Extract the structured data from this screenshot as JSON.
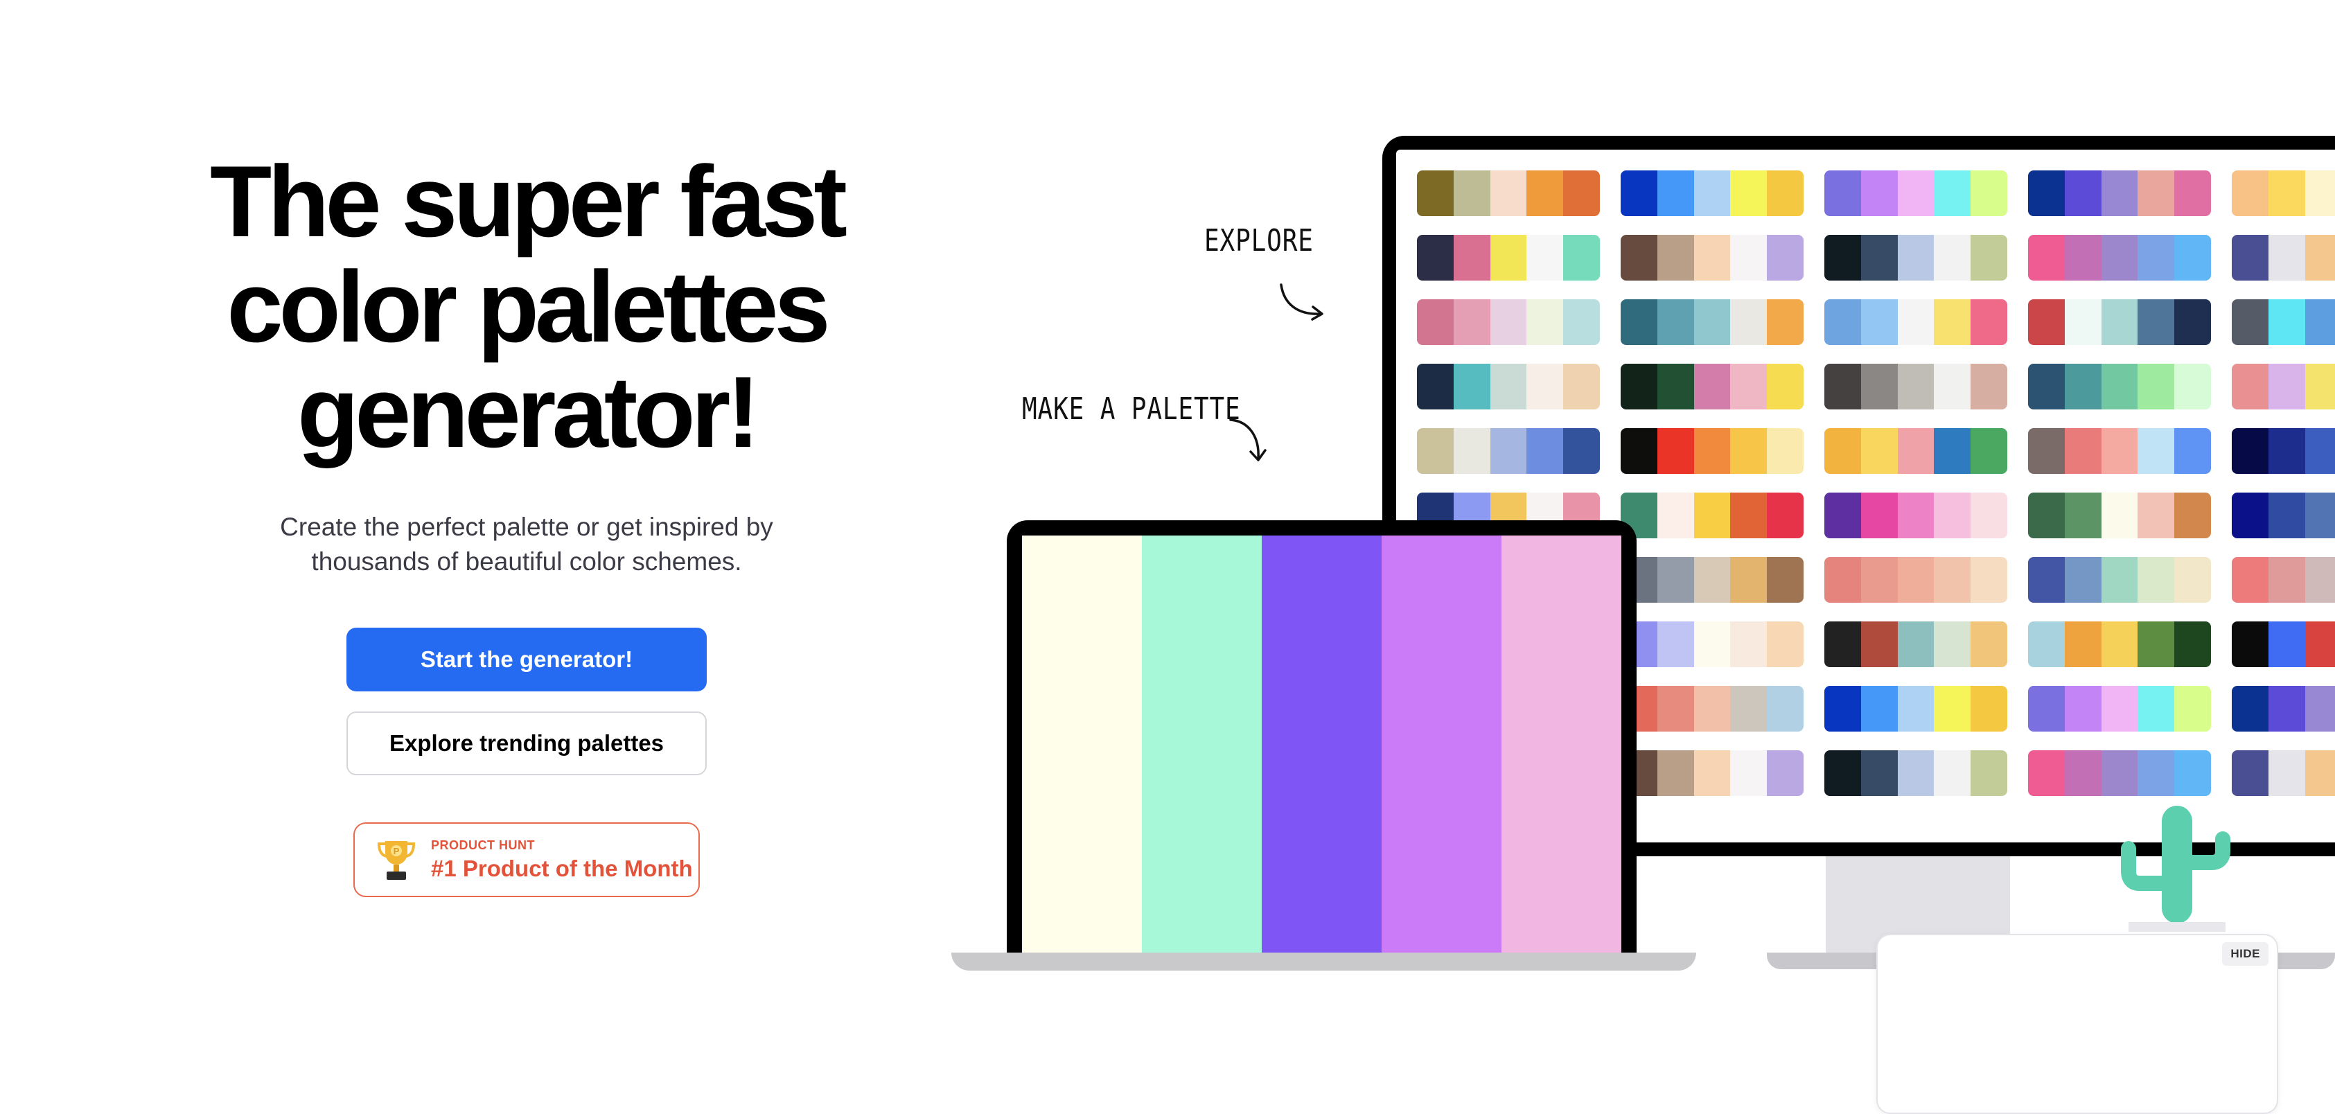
{
  "hero": {
    "title_lines": [
      "The super fast",
      "color palettes",
      "generator!"
    ],
    "subtitle_lines": [
      "Create the perfect palette or get inspired by",
      "thousands of beautiful color schemes."
    ],
    "primary_button": "Start the generator!",
    "secondary_button": "Explore trending palettes"
  },
  "badge": {
    "kicker": "PRODUCT HUNT",
    "title": "#1 Product of the Month",
    "icon": "trophy-icon"
  },
  "annotations": {
    "explore": "EXPLORE",
    "make": "MAKE A PALETTE"
  },
  "widget": {
    "hide_label": "HIDE"
  },
  "colors": {
    "primary": "#246bf2",
    "badge_accent": "#e3533a",
    "cactus": "#5ccfae"
  },
  "laptop_palette": [
    "#fffeea",
    "#a6f8d9",
    "#7f55f5",
    "#cb7bf8",
    "#f2b6e3"
  ],
  "monitor_palettes": [
    [
      "#7d6a24",
      "#bdbc94",
      "#f8dccb",
      "#ef9b3b",
      "#e06f37"
    ],
    [
      "#0936c1",
      "#4598f7",
      "#aed2f4",
      "#f5f55a",
      "#f5c842"
    ],
    [
      "#7a70e0",
      "#c384f6",
      "#f1b4f4",
      "#77f2f2",
      "#d8fd8a"
    ],
    [
      "#0b3291",
      "#5b4bd6",
      "#9887d2",
      "#e9a69c",
      "#e06fa3"
    ],
    [
      "#f8c287",
      "#fbd85e",
      "#fdf3cc",
      "#e9d4aa",
      "#ed8c3a"
    ],
    [
      "#2c2d46",
      "#da7091",
      "#f3e656",
      "#f6f6f6",
      "#75dbba"
    ],
    [
      "#684b3f",
      "#b99e88",
      "#f7d4b4",
      "#f6f4f4",
      "#b9a8e1"
    ],
    [
      "#111b22",
      "#374b66",
      "#b8c8e5",
      "#f2f2f2",
      "#c2cc99"
    ],
    [
      "#ef5b93",
      "#c36fb6",
      "#9c86cc",
      "#7ba3e5",
      "#61b6f6"
    ],
    [
      "#4a4e92",
      "#e4e4ea",
      "#f4c78f",
      "#e9a46c",
      "#f7e5cd"
    ],
    [
      "#d17590",
      "#e49fb5",
      "#e8d0e3",
      "#eef3df",
      "#b9dee0"
    ],
    [
      "#2f6b7d",
      "#5fa1b1",
      "#90c6ce",
      "#eae8e3",
      "#f2a94a"
    ],
    [
      "#6ea5e0",
      "#94c6f4",
      "#f4f4f4",
      "#f8e16e",
      "#ef6a89"
    ],
    [
      "#cb4649",
      "#eef9f5",
      "#a8d7d3",
      "#4f7599",
      "#1e2f52"
    ],
    [
      "#555c67",
      "#5fe6f5",
      "#5d9ee0",
      "#e8714a",
      "#a84d3f"
    ],
    [
      "#1c2c44",
      "#56bcc0",
      "#c9dbd4",
      "#f6eee7",
      "#efd2b0"
    ],
    [
      "#12231a",
      "#215132",
      "#d37daa",
      "#efb7c4",
      "#f6dc50"
    ],
    [
      "#454140",
      "#8b8784",
      "#c0bcb6",
      "#f1f1ef",
      "#d6aea2"
    ],
    [
      "#2c5371",
      "#4c9a9c",
      "#72c8a1",
      "#9eea9e",
      "#d6fbd6"
    ],
    [
      "#e99192",
      "#d9b4ea",
      "#f4e36d",
      "#e7b4bb",
      "#c4e8ed"
    ],
    [
      "#cbc29b",
      "#e9e8e0",
      "#a5b7e1",
      "#6d8ee0",
      "#33549d"
    ],
    [
      "#0e0e0d",
      "#ea3428",
      "#f28a3d",
      "#f7c547",
      "#fbeaad"
    ],
    [
      "#f2b33f",
      "#f9d65e",
      "#efa3a9",
      "#2f7bbf",
      "#4ba860"
    ],
    [
      "#7a6b69",
      "#ea7b7b",
      "#f4a9a1",
      "#c0e4f6",
      "#5f93f4"
    ],
    [
      "#060a47",
      "#1c2d8e",
      "#3c5fbf",
      "#66e0bf",
      "#dbeed8"
    ],
    [
      "#1f3474",
      "#8d9af1",
      "#f3c65d",
      "#f7f3f3",
      "#e993a8"
    ],
    [
      "#3d8a6f",
      "#fcefe9",
      "#f8ce44",
      "#e06436",
      "#e7334a"
    ],
    [
      "#5e2fa0",
      "#e647a2",
      "#ee82c7",
      "#f5bfdd",
      "#f9dfe3"
    ],
    [
      "#3b6a4b",
      "#5d9466",
      "#fcfbeb",
      "#f1c2b5",
      "#d2884d"
    ],
    [
      "#0b1189",
      "#2f4ca2",
      "#5274b3",
      "#8cb1d6",
      "#a4cbe3"
    ],
    [
      "#5c5e7e",
      "#a598bf",
      "#b5c3da",
      "#d5f3ea",
      "#d8c99f"
    ],
    [
      "#6a737f",
      "#949ca9",
      "#d7c9b5",
      "#e3b46e",
      "#9e7452"
    ],
    [
      "#e5837d",
      "#e99c8d",
      "#eeae9a",
      "#f1c3aa",
      "#f6dcc0"
    ],
    [
      "#4356a5",
      "#7597c6",
      "#9fd7c3",
      "#d9e9c9",
      "#f2e7c9"
    ],
    [
      "#ee7b7b",
      "#df9a9a",
      "#d0b9b9",
      "#b6dad8",
      "#abf5f1"
    ],
    [
      "#a1538e",
      "#d274a5",
      "#e3ab9f",
      "#f2e0b6",
      "#adf2df"
    ],
    [
      "#9090f0",
      "#c0c4f4",
      "#fcfbee",
      "#f9eadf",
      "#f7d7b4"
    ],
    [
      "#222222",
      "#ae4b3d",
      "#8cbfbd",
      "#d8e4d2",
      "#f1c57a"
    ],
    [
      "#a9d2df",
      "#eea33e",
      "#f6d15a",
      "#5c8d40",
      "#1e4720"
    ],
    [
      "#0b0b0b",
      "#3f6cf2",
      "#d8433f",
      "#f6c651",
      "#e8e8e4"
    ],
    [
      "#f3f155",
      "#d1f27c",
      "#a9ef96",
      "#86ecc1",
      "#6be9ee"
    ],
    [
      "#e36a5b",
      "#e88b7f",
      "#f2c0a8",
      "#ccc6bd",
      "#b1d0e4"
    ],
    [
      "#0936c1",
      "#4598f7",
      "#aed2f4",
      "#f5f55a",
      "#f5c842"
    ],
    [
      "#7a70e0",
      "#c384f6",
      "#f1b4f4",
      "#77f2f2",
      "#d8fd8a"
    ],
    [
      "#0b3291",
      "#5b4bd6",
      "#9887d2",
      "#e9a69c",
      "#e06fa3"
    ],
    [
      "#f8c287",
      "#fbd85e",
      "#fdf3cc",
      "#e9d4aa",
      "#ed8c3a"
    ],
    [
      "#684b3f",
      "#b99e88",
      "#f7d4b4",
      "#f6f4f4",
      "#b9a8e1"
    ],
    [
      "#111b22",
      "#374b66",
      "#b8c8e5",
      "#f2f2f2",
      "#c2cc99"
    ],
    [
      "#ef5b93",
      "#c36fb6",
      "#9c86cc",
      "#7ba3e5",
      "#61b6f6"
    ],
    [
      "#4a4e92",
      "#e4e4ea",
      "#f4c78f",
      "#e9a46c",
      "#f7e5cd"
    ]
  ]
}
